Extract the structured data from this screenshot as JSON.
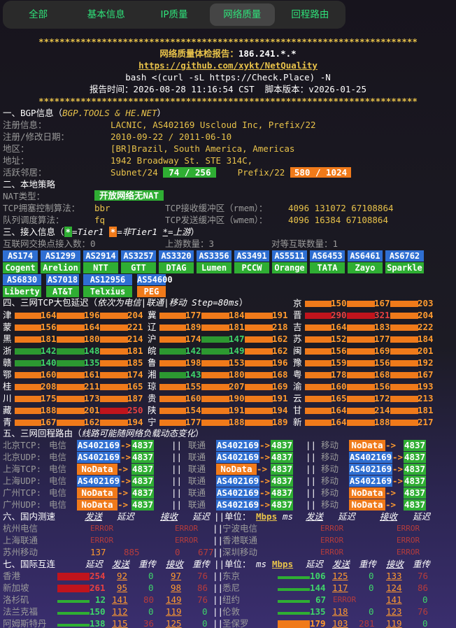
{
  "tabs": [
    "全部",
    "基本信息",
    "IP质量",
    "网络质量",
    "回程路由"
  ],
  "header": {
    "stars": "************************************************************************",
    "title": "网络质量体检报告：",
    "ip": "186.241.*.*",
    "link": "https://github.com/xykt/NetQuality",
    "cmd": "bash <(curl -sL https://Check.Place) -N",
    "report_label": "报告时间：",
    "report_time": "2026-08-28 11:16:54 CST",
    "script_label": "脚本版本：",
    "script_ver": "v2026-01-25"
  },
  "bgp": {
    "section": "一、BGP信息（",
    "source": "BGP.TOOLS & HE.NET",
    "section_end": "）",
    "rows": [
      {
        "label": "注册信息：",
        "value": "LACNIC, AS402169 Uscloud Inc, Prefix/22"
      },
      {
        "label": "注册/修改日期：",
        "value": "2010-09-22 / 2011-06-10"
      },
      {
        "label": "地区：",
        "value": "[BR]Brazil, South America, Americas"
      },
      {
        "label": "地址：",
        "value": "1942 Broadway St. STE 314C,"
      }
    ],
    "neighbor_label": "活跃邻居：",
    "subnet_label": "Subnet/24",
    "subnet_val": "74 / 256",
    "prefix_label": "Prefix/22",
    "prefix_val": "580 / 1024"
  },
  "local": {
    "section": "二、本地策略",
    "nat_label": "NAT类型：",
    "nat_val": "开放网络无NAT",
    "cc_label": "TCP拥塞控制算法：",
    "cc_val": "bbr",
    "rmem_label": "TCP接收缓冲区（rmem）：",
    "rmem_val": "4096 131072 67108864",
    "qd_label": "队列调度算法：",
    "qd_val": "fq",
    "wmem_label": "TCP发送缓冲区（wmem）：",
    "wmem_val": "4096 16384 67108864"
  },
  "access": {
    "section": "三、接入信息（",
    "tier1_mark": "*",
    "tier1": "=Tier1 ",
    "nontier1_mark": "*",
    "nontier1": "=非Tier1 ",
    "up_mark": "*",
    "up": "=上游",
    "section_end": "）",
    "ix_label": "互联网交换点接入数：0",
    "up_label": "上游数量：3",
    "peer_label": "对等互联数量：1",
    "as_rows": [
      [
        {
          "as": "AS174",
          "name": "Cogent"
        },
        {
          "as": "AS1299",
          "name": "Arelion"
        },
        {
          "as": "AS2914",
          "name": "NTT"
        },
        {
          "as": "AS3257",
          "name": "GTT"
        },
        {
          "as": "AS3320",
          "name": "DTAG"
        },
        {
          "as": "AS3356",
          "name": "Lumen"
        },
        {
          "as": "AS3491",
          "name": "PCCW"
        },
        {
          "as": "AS5511",
          "name": "Orange"
        },
        {
          "as": "AS6453",
          "name": "TATA"
        },
        {
          "as": "AS6461",
          "name": "Zayo"
        },
        {
          "as": "AS6762",
          "name": "Sparkle"
        }
      ],
      [
        {
          "as": "AS6830",
          "name": "Liberty"
        },
        {
          "as": "AS7018",
          "name": "AT&T"
        },
        {
          "as": "AS12956",
          "name": "Telxius"
        },
        {
          "as": "AS54600",
          "name": "PEG",
          "peer": true
        }
      ]
    ]
  },
  "latency": {
    "section": "四、三网TCP大包延迟（",
    "note": "依次为电信|联通|移动 Step=80ms",
    "section_end": "）",
    "rows": [
      [
        "京",
        "150",
        "167",
        "203"
      ],
      [
        "津",
        "164",
        "196",
        "204",
        "冀",
        "177",
        "184",
        "191",
        "晋",
        "290",
        "321",
        "204"
      ],
      [
        "蒙",
        "156",
        "164",
        "221",
        "辽",
        "189",
        "181",
        "218",
        "吉",
        "164",
        "183",
        "222"
      ],
      [
        "黑",
        "181",
        "180",
        "214",
        "沪",
        "174",
        "147",
        "162",
        "苏",
        "152",
        "177",
        "184"
      ],
      [
        "浙",
        "142",
        "148",
        "181",
        "皖",
        "142",
        "149",
        "162",
        "闽",
        "156",
        "169",
        "201"
      ],
      [
        "赣",
        "140",
        "135",
        "185",
        "鲁",
        "198",
        "153",
        "196",
        "豫",
        "159",
        "156",
        "192"
      ],
      [
        "鄂",
        "160",
        "161",
        "174",
        "湘",
        "143",
        "180",
        "168",
        "粤",
        "178",
        "168",
        "167"
      ],
      [
        "桂",
        "208",
        "211",
        "165",
        "琼",
        "155",
        "207",
        "169",
        "渝",
        "160",
        "156",
        "193"
      ],
      [
        "川",
        "175",
        "173",
        "187",
        "贵",
        "160",
        "190",
        "191",
        "云",
        "165",
        "172",
        "213"
      ],
      [
        "藏",
        "188",
        "201",
        "250",
        "陕",
        "154",
        "191",
        "194",
        "甘",
        "164",
        "214",
        "181"
      ],
      [
        "青",
        "167",
        "162",
        "194",
        "宁",
        "177",
        "188",
        "189",
        "新",
        "164",
        "188",
        "217"
      ]
    ]
  },
  "route": {
    "section": "五、三网回程路由（",
    "note": "线路可能随网络负载动态变化",
    "section_end": "）",
    "sep": "||",
    "arrow": "->",
    "dst": "4837",
    "rows": [
      {
        "city": "北京TCP:",
        "ct": "电信",
        "ct_as": "AS402169",
        "cu": "联通",
        "cu_as": "AS402169",
        "cm": "移动",
        "cm_as": "NoData"
      },
      {
        "city": "北京UDP:",
        "ct": "电信",
        "ct_as": "AS402169",
        "cu": "联通",
        "cu_as": "AS402169",
        "cm": "移动",
        "cm_as": "AS402169"
      },
      {
        "city": "上海TCP:",
        "ct": "电信",
        "ct_as": "NoData",
        "cu": "联通",
        "cu_as": "NoData",
        "cm": "移动",
        "cm_as": "AS402169"
      },
      {
        "city": "上海UDP:",
        "ct": "电信",
        "ct_as": "AS402169",
        "cu": "联通",
        "cu_as": "AS402169",
        "cm": "移动",
        "cm_as": "AS402169"
      },
      {
        "city": "广州TCP:",
        "ct": "电信",
        "ct_as": "NoData",
        "cu": "联通",
        "cu_as": "AS402169",
        "cm": "移动",
        "cm_as": "NoData"
      },
      {
        "city": "广州UDP:",
        "ct": "电信",
        "ct_as": "NoData",
        "cu": "联通",
        "cu_as": "AS402169",
        "cm": "移动",
        "cm_as": "NoData"
      }
    ]
  },
  "domestic": {
    "section": "六、国内测速",
    "h_send": "发送",
    "h_lat": "延迟",
    "h_recv": "接收",
    "h_lat2": "延迟",
    "unit_label": "||单位：",
    "unit_mbps": "Mbps",
    "unit_ms": "ms",
    "rows": [
      {
        "l": "杭州电信",
        "lv": [
          "ERROR",
          "",
          "ERROR",
          ""
        ],
        "r": "宁波电信",
        "rv": [
          "ERROR",
          "",
          "ERROR",
          ""
        ]
      },
      {
        "l": "上海联通",
        "lv": [
          "ERROR",
          "",
          "ERROR",
          ""
        ],
        "r": "香港联通",
        "rv": [
          "ERROR",
          "",
          "ERROR",
          ""
        ]
      },
      {
        "l": "苏州移动",
        "lv": [
          "137",
          "885",
          "0",
          "677"
        ],
        "r": "深圳移动",
        "rv": [
          "ERROR",
          "",
          "ERROR",
          ""
        ]
      }
    ]
  },
  "intl": {
    "section": "七、国际互连",
    "h_lat": "延迟",
    "h_send": "发送",
    "h_re": "重传",
    "h_recv": "接收",
    "h_re2": "重传",
    "unit_label": "||单位：",
    "unit_ms": "ms",
    "unit_mbps": "Mbps",
    "rows": [
      {
        "l": "香港",
        "lv": [
          "254",
          "92",
          "0",
          "97",
          "76"
        ],
        "r": "东京",
        "rv": [
          "106",
          "125",
          "0",
          "133",
          "76"
        ]
      },
      {
        "l": "新加坡",
        "lv": [
          "261",
          "95",
          "0",
          "98",
          "86"
        ],
        "r": "悉尼",
        "rv": [
          "144",
          "117",
          "0",
          "124",
          "86"
        ]
      },
      {
        "l": "洛杉矶",
        "lv": [
          "12",
          "141",
          "80",
          "149",
          "76"
        ],
        "r": "纽约",
        "rv": [
          "67",
          "ERROR",
          "",
          "141",
          "0"
        ]
      },
      {
        "l": "法兰克福",
        "lv": [
          "150",
          "112",
          "0",
          "119",
          "0"
        ],
        "r": "伦敦",
        "rv": [
          "135",
          "118",
          "0",
          "123",
          "76"
        ]
      },
      {
        "l": "阿姆斯特丹",
        "lv": [
          "138",
          "115",
          "36",
          "125",
          "0"
        ],
        "r": "圣保罗",
        "rv": [
          "179",
          "103",
          "281",
          "119",
          "0"
        ]
      }
    ]
  }
}
